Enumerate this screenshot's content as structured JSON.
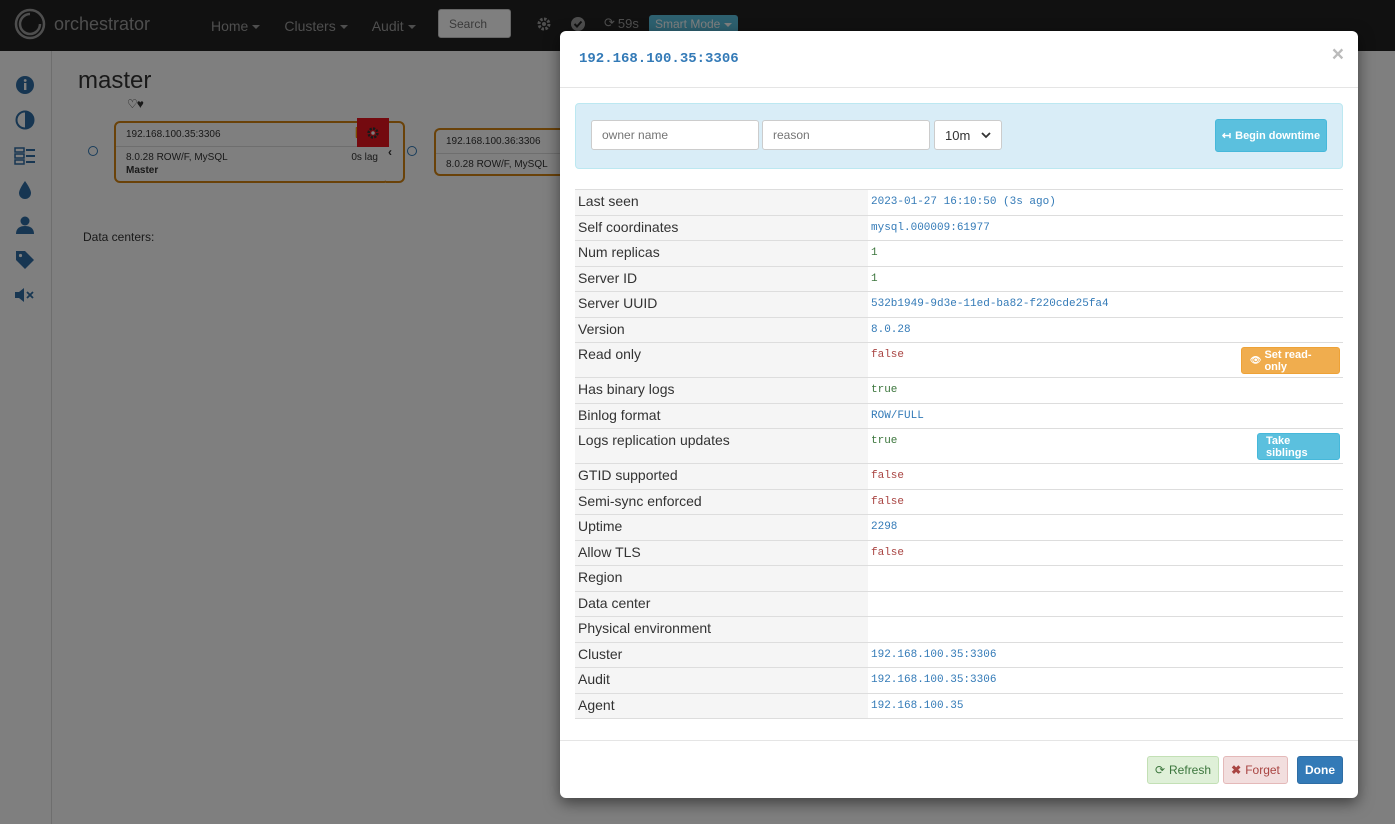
{
  "navbar": {
    "brand": "orchestrator",
    "menu": [
      {
        "label": "Home"
      },
      {
        "label": "Clusters"
      },
      {
        "label": "Audit"
      }
    ],
    "search_placeholder": "Search",
    "refresh_countdown": "59s",
    "mode_label": "Smart Mode"
  },
  "sidebar": {
    "icons": [
      "info-icon",
      "contrast-icon",
      "database-list-icon",
      "drop-icon",
      "user-icon",
      "tag-icon",
      "mute-icon"
    ]
  },
  "main": {
    "title": "master",
    "hearts": "♡♥",
    "node1": {
      "host": "192.168.100.35:3306",
      "version": "8.0.28 ROW/F, MySQL",
      "lag": "0s lag",
      "role": "Master"
    },
    "node2": {
      "host": "192.168.100.36:3306",
      "version": "8.0.28 ROW/F, MySQL"
    },
    "datacenters_label": "Data centers:"
  },
  "modal": {
    "title": "192.168.100.35:3306",
    "close": "×",
    "downtime": {
      "owner_placeholder": "owner name",
      "reason_placeholder": "reason",
      "duration": "10m",
      "begin_label": "Begin downtime"
    },
    "props": [
      {
        "key": "Last seen",
        "value": "2023-01-27 16:10:50 (3s ago)",
        "color": "#337ab7"
      },
      {
        "key": "Self coordinates",
        "value": "mysql.000009:61977",
        "color": "#337ab7"
      },
      {
        "key": "Num replicas",
        "value": "1",
        "color": "#3c763d"
      },
      {
        "key": "Server ID",
        "value": "1",
        "color": "#3c763d"
      },
      {
        "key": "Server UUID",
        "value": "532b1949-9d3e-11ed-ba82-f220cde25fa4",
        "color": "#337ab7"
      },
      {
        "key": "Version",
        "value": "8.0.28",
        "color": "#337ab7"
      },
      {
        "key": "Read only",
        "value": "false",
        "color": "#a94442",
        "button": "Set read-only"
      },
      {
        "key": "Has binary logs",
        "value": "true",
        "color": "#3c763d"
      },
      {
        "key": "Binlog format",
        "value": "ROW/FULL",
        "color": "#337ab7"
      },
      {
        "key": "Logs replication updates",
        "value": "true",
        "color": "#3c763d",
        "button": "Take siblings"
      },
      {
        "key": "GTID supported",
        "value": "false",
        "color": "#a94442"
      },
      {
        "key": "Semi-sync enforced",
        "value": "false",
        "color": "#a94442"
      },
      {
        "key": "Uptime",
        "value": "2298",
        "color": "#337ab7"
      },
      {
        "key": "Allow TLS",
        "value": "false",
        "color": "#a94442"
      },
      {
        "key": "Region",
        "value": ""
      },
      {
        "key": "Data center",
        "value": ""
      },
      {
        "key": "Physical environment",
        "value": ""
      },
      {
        "key": "Cluster",
        "value": "192.168.100.35:3306",
        "color": "#337ab7"
      },
      {
        "key": "Audit",
        "value": "192.168.100.35:3306",
        "color": "#337ab7"
      },
      {
        "key": "Agent",
        "value": "192.168.100.35",
        "color": "#337ab7"
      }
    ],
    "footer": {
      "refresh": "Refresh",
      "forget": "Forget",
      "done": "Done"
    }
  }
}
